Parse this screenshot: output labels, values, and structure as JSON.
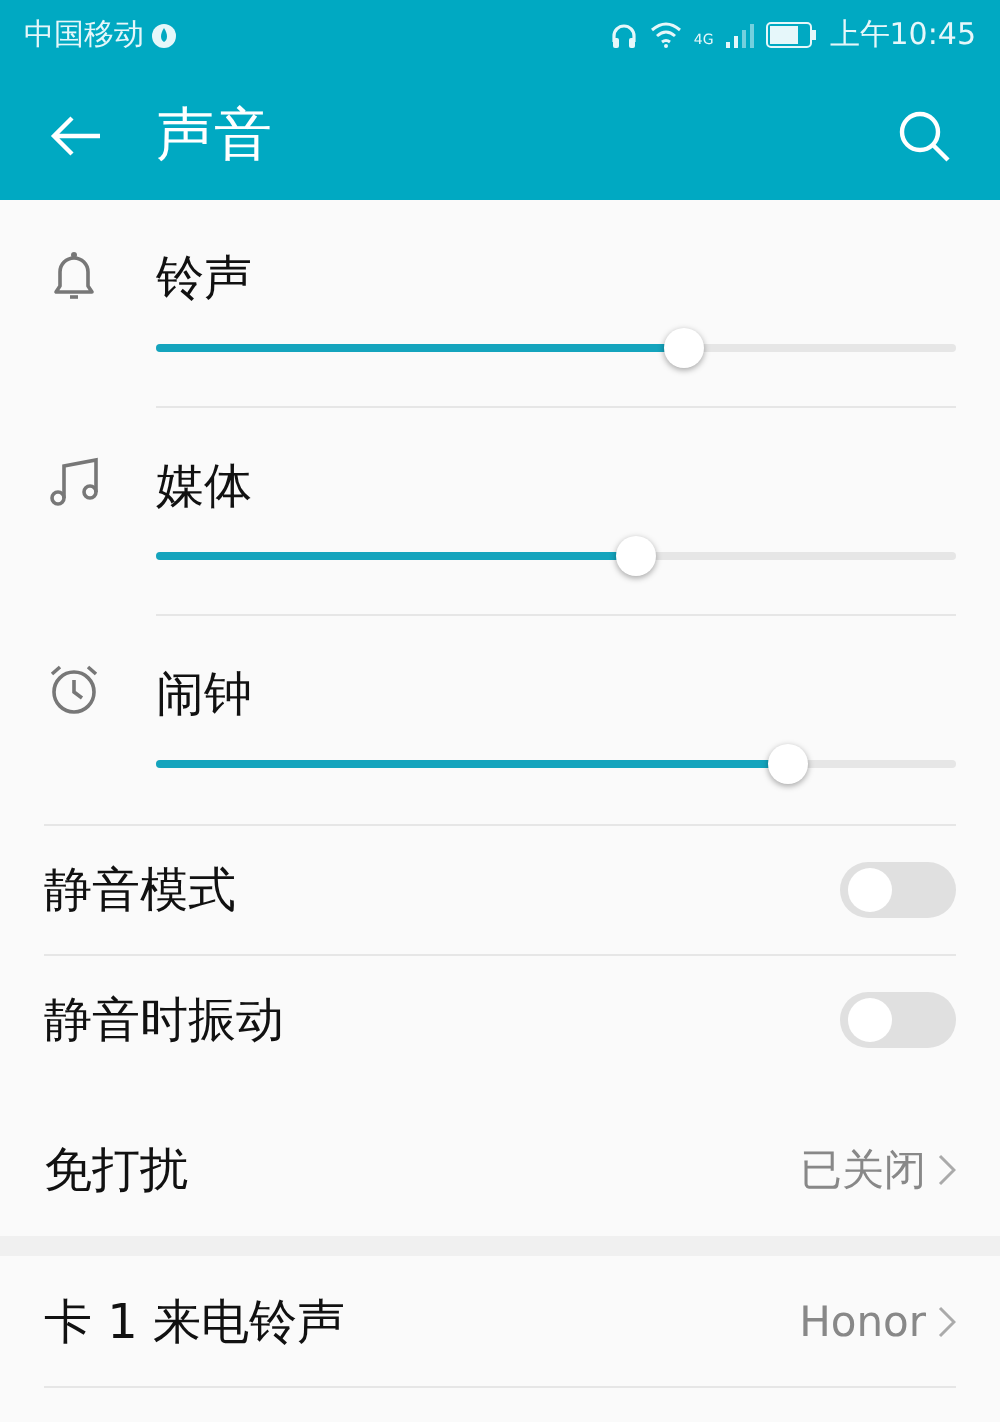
{
  "status_bar": {
    "carrier": "中国移动",
    "network": "4G",
    "time": "上午10:45"
  },
  "toolbar": {
    "title": "声音"
  },
  "volumes": [
    {
      "kind": "bell",
      "label": "铃声",
      "level": 0.66
    },
    {
      "kind": "music",
      "label": "媒体",
      "level": 0.6
    },
    {
      "kind": "alarm",
      "label": "闹钟",
      "level": 0.79
    }
  ],
  "toggles": [
    {
      "label": "静音模式",
      "on": false
    },
    {
      "label": "静音时振动",
      "on": false
    }
  ],
  "links": [
    {
      "label": "免打扰",
      "value": "已关闭"
    },
    {
      "label": "卡 1 来电铃声",
      "value": "Honor"
    }
  ]
}
